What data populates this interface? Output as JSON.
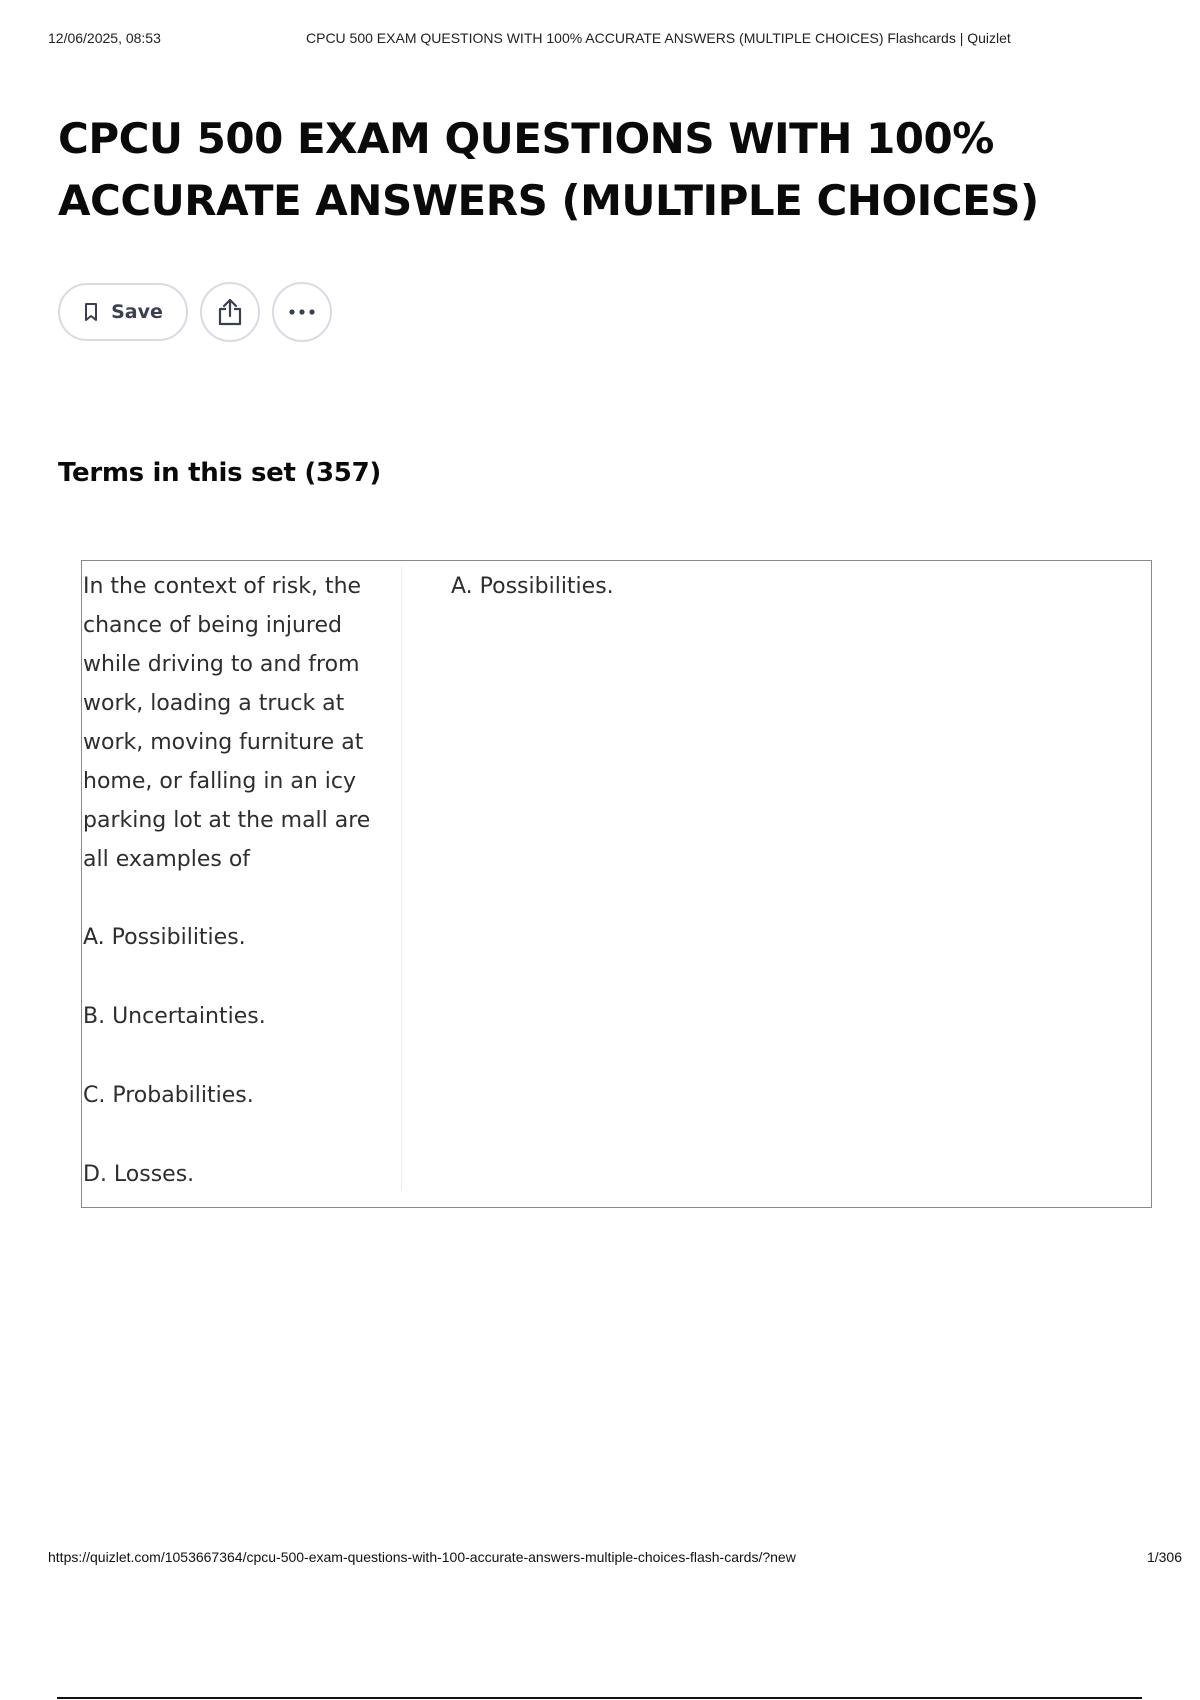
{
  "print_header": {
    "date": "12/06/2025, 08:53",
    "title": "CPCU 500 EXAM QUESTIONS WITH 100% ACCURATE ANSWERS (MULTIPLE CHOICES) Flashcards | Quizlet"
  },
  "set": {
    "title": "CPCU 500 EXAM QUESTIONS WITH 100% ACCURATE ANSWERS (MULTIPLE CHOICES)"
  },
  "actions": {
    "save_label": "Save",
    "share_icon": "share-icon",
    "more_icon": "more-horizontal-icon",
    "save_icon": "bookmark-icon"
  },
  "terms": {
    "heading": "Terms in this set (357)"
  },
  "cards": [
    {
      "term": {
        "question": "In the context of risk, the chance of being injured while driving to and from work, loading a truck at work, moving furniture at home, or falling in an icy parking lot at the mall are all examples of",
        "options": [
          "A. Possibilities.",
          "B. Uncertainties.",
          "C. Probabilities.",
          "D. Losses."
        ]
      },
      "definition": "A. Possibilities."
    }
  ],
  "print_footer": {
    "url": "https://quizlet.com/1053667364/cpcu-500-exam-questions-with-100-accurate-answers-multiple-choices-flash-cards/?new",
    "page": "1/306"
  },
  "colors": {
    "text": "#111111",
    "button_border": "#d9dbe3",
    "button_text": "#3a4052",
    "card_border": "#8a8a8a"
  }
}
